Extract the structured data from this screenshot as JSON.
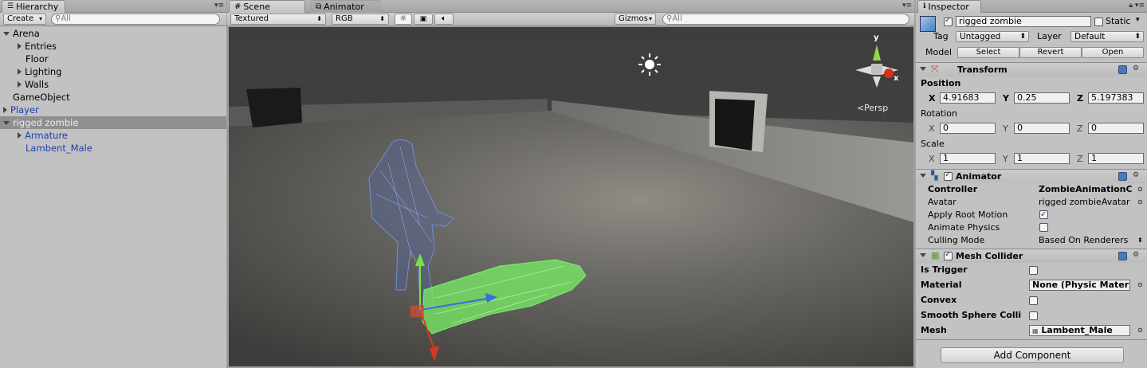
{
  "hierarchy": {
    "tab": "Hierarchy",
    "create": "Create",
    "search_placeholder": "All",
    "items": [
      {
        "label": "Arena"
      },
      {
        "label": "Entries"
      },
      {
        "label": "Floor"
      },
      {
        "label": "Lighting"
      },
      {
        "label": "Walls"
      },
      {
        "label": "GameObject"
      },
      {
        "label": "Player"
      },
      {
        "label": "rigged zombie"
      },
      {
        "label": "Armature"
      },
      {
        "label": "Lambent_Male"
      }
    ]
  },
  "scene": {
    "tabs": [
      "Scene",
      "Animator"
    ],
    "render_mode": "Textured",
    "color_mode": "RGB",
    "gizmos": "Gizmos",
    "search_placeholder": "All",
    "persp": "Persp",
    "axis_y": "y",
    "axis_x": "x"
  },
  "inspector": {
    "tab": "Inspector",
    "name": "rigged zombie",
    "static_label": "Static",
    "tag_label": "Tag",
    "tag_value": "Untagged",
    "layer_label": "Layer",
    "layer_value": "Default",
    "model_label": "Model",
    "model_buttons": [
      "Select",
      "Revert",
      "Open"
    ],
    "transform": {
      "title": "Transform",
      "position_label": "Position",
      "position": {
        "x": "4.91683",
        "y": "0.25",
        "z": "5.197383"
      },
      "rotation_label": "Rotation",
      "rotation": {
        "x": "0",
        "y": "0",
        "z": "0"
      },
      "scale_label": "Scale",
      "scale": {
        "x": "1",
        "y": "1",
        "z": "1"
      },
      "axis_x": "X",
      "axis_y": "Y",
      "axis_z": "Z"
    },
    "animator": {
      "title": "Animator",
      "controller_label": "Controller",
      "controller_value": "ZombieAnimationC",
      "avatar_label": "Avatar",
      "avatar_value": "rigged zombieAvatar",
      "root_motion_label": "Apply Root Motion",
      "animate_physics_label": "Animate Physics",
      "culling_label": "Culling Mode",
      "culling_value": "Based On Renderers"
    },
    "mesh_collider": {
      "title": "Mesh Collider",
      "is_trigger_label": "Is Trigger",
      "material_label": "Material",
      "material_value": "None (Physic Mater",
      "convex_label": "Convex",
      "smooth_label": "Smooth Sphere Colli",
      "mesh_label": "Mesh",
      "mesh_value": "Lambent_Male"
    },
    "add_component": "Add Component"
  }
}
